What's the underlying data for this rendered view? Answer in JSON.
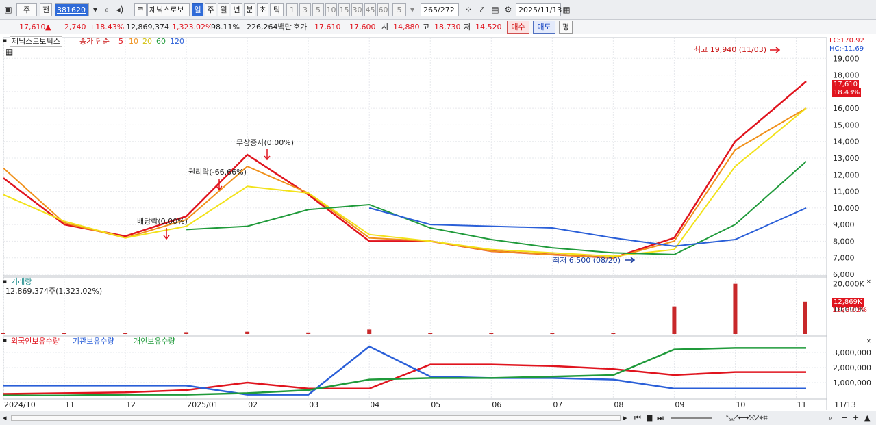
{
  "toolbar": {
    "market": "주",
    "prev": "전",
    "code": "381620",
    "code_button": "코",
    "stock_name": "제닉스로보",
    "periods": [
      "일",
      "주",
      "월",
      "년",
      "분",
      "초",
      "틱"
    ],
    "period_selected": "일",
    "intervals": [
      "1",
      "3",
      "5",
      "10",
      "15",
      "30",
      "45",
      "60"
    ],
    "interval_value": "5",
    "count": "265",
    "count_total": "/272",
    "date": "2025/11/13"
  },
  "info": {
    "price": "17,610",
    "change_arrow": "▲",
    "change": "2,740",
    "change_pct": "+18.43%",
    "volume": "12,869,374",
    "volume_ratio": "1,323.02%",
    "ratio2": "98.11%",
    "amount": "226,264백만",
    "quote_label": "호가",
    "ask": "17,610",
    "bid": "17,600",
    "open_label": "시",
    "open": "14,880",
    "high_label": "고",
    "high": "18,730",
    "low_label": "저",
    "low": "14,520",
    "buy": "매수",
    "sell": "매도",
    "avg": "평"
  },
  "price_pane": {
    "stock_label": "제닉스로보틱스",
    "ma_title": "종가 단순",
    "ma_periods": [
      "5",
      "10",
      "20",
      "60",
      "120"
    ],
    "ma_colors": [
      "#e0141e",
      "#f0901a",
      "#f2e21a",
      "#1f9a3a",
      "#2a5fd8"
    ],
    "lc": "LC:170.92",
    "hc": "HC:-11.69",
    "y_ticks": [
      "19,000",
      "18,000",
      "17,000",
      "16,000",
      "15,000",
      "14,000",
      "13,000",
      "12,000",
      "11,000",
      "10,000",
      "9,000",
      "8,000",
      "7,000",
      "6,000"
    ],
    "last_price_tag": "17,610",
    "last_pct_tag": "18.43%",
    "annotations": {
      "high": "최고 19,940 (11/03)",
      "low": "최저 6,500 (08/20)",
      "rights": "권리락(-66.66%)",
      "bonus": "무상증자(0.00%)",
      "dividend": "배당락(0.00%)"
    }
  },
  "volume_pane": {
    "title": "거래량",
    "value_text": "12,869,374주(1,323.02%)",
    "y_ticks": [
      "20,000K",
      "10,000K"
    ],
    "last_tag": "12,869K",
    "last_pct": "1323.02%"
  },
  "holdings_pane": {
    "series_labels": [
      "외국인보유수량",
      "기관보유수량",
      "개인보유수량"
    ],
    "series_colors": [
      "#e0141e",
      "#2a5fd8",
      "#1f9a3a"
    ],
    "y_ticks": [
      "3,000,000",
      "2,000,000",
      "1,000,000"
    ]
  },
  "x_axis": {
    "labels": [
      "2024/10",
      "11",
      "12",
      "2025/01",
      "02",
      "03",
      "04",
      "05",
      "06",
      "07",
      "08",
      "09",
      "10",
      "11"
    ],
    "right_label": "11/13"
  },
  "chart_data": [
    {
      "type": "line",
      "title": "제닉스로보틱스 종가 단순",
      "x": [
        "2024/10",
        "2024/11",
        "2024/12",
        "2025/01",
        "2025/02",
        "2025/03",
        "2025/04",
        "2025/05",
        "2025/06",
        "2025/07",
        "2025/08",
        "2025/09",
        "2025/10",
        "2025/11/13"
      ],
      "series": [
        {
          "name": "5",
          "values": [
            11800,
            9000,
            8300,
            9500,
            13200,
            10800,
            8000,
            8000,
            7400,
            7200,
            7000,
            8200,
            14000,
            17610
          ]
        },
        {
          "name": "10",
          "values": [
            12400,
            9100,
            8200,
            9300,
            12500,
            10900,
            8200,
            8000,
            7400,
            7200,
            7000,
            8000,
            13500,
            16000
          ]
        },
        {
          "name": "20",
          "values": [
            10800,
            9200,
            8200,
            8900,
            11300,
            10900,
            8400,
            8000,
            7500,
            7300,
            7100,
            7500,
            12500,
            16000
          ]
        },
        {
          "name": "60",
          "values": [
            null,
            null,
            null,
            8700,
            8900,
            9900,
            10200,
            8800,
            8100,
            7600,
            7300,
            7200,
            9000,
            12800
          ]
        },
        {
          "name": "120",
          "values": [
            null,
            null,
            null,
            null,
            null,
            null,
            10000,
            9000,
            8900,
            8800,
            8200,
            7700,
            8100,
            10000
          ]
        }
      ],
      "ylim": [
        6000,
        20000
      ],
      "annotations": [
        "최고 19,940 (11/03)",
        "최저 6,500 (08/20)",
        "권리락(-66.66%)",
        "무상증자(0.00%)",
        "배당락(0.00%)"
      ]
    },
    {
      "type": "bar",
      "title": "거래량",
      "categories": [
        "2024/10",
        "2024/11",
        "2024/12",
        "2025/01",
        "2025/02",
        "2025/03",
        "2025/04",
        "2025/05",
        "2025/06",
        "2025/07",
        "2025/08",
        "2025/09",
        "2025/10",
        "2025/11/13"
      ],
      "values": [
        400,
        400,
        300,
        700,
        900,
        600,
        1800,
        500,
        300,
        300,
        300,
        11000,
        20000,
        12869
      ],
      "ylabel": "K"
    },
    {
      "type": "line",
      "title": "보유수량",
      "x": [
        "2024/10",
        "2024/11",
        "2024/12",
        "2025/01",
        "2025/02",
        "2025/03",
        "2025/04",
        "2025/05",
        "2025/06",
        "2025/07",
        "2025/08",
        "2025/09",
        "2025/10",
        "2025/11/13"
      ],
      "series": [
        {
          "name": "외국인보유수량",
          "values": [
            250000,
            300000,
            350000,
            500000,
            1000000,
            600000,
            600000,
            2200000,
            2200000,
            2100000,
            1900000,
            1500000,
            1700000,
            1700000
          ]
        },
        {
          "name": "기관보유수량",
          "values": [
            800000,
            800000,
            800000,
            800000,
            200000,
            200000,
            3400000,
            1400000,
            1300000,
            1300000,
            1200000,
            600000,
            600000,
            600000
          ]
        },
        {
          "name": "개인보유수량",
          "values": [
            150000,
            150000,
            200000,
            200000,
            300000,
            500000,
            1200000,
            1300000,
            1300000,
            1400000,
            1500000,
            3200000,
            3300000,
            3300000
          ]
        }
      ],
      "ylim": [
        0,
        3500000
      ]
    }
  ]
}
